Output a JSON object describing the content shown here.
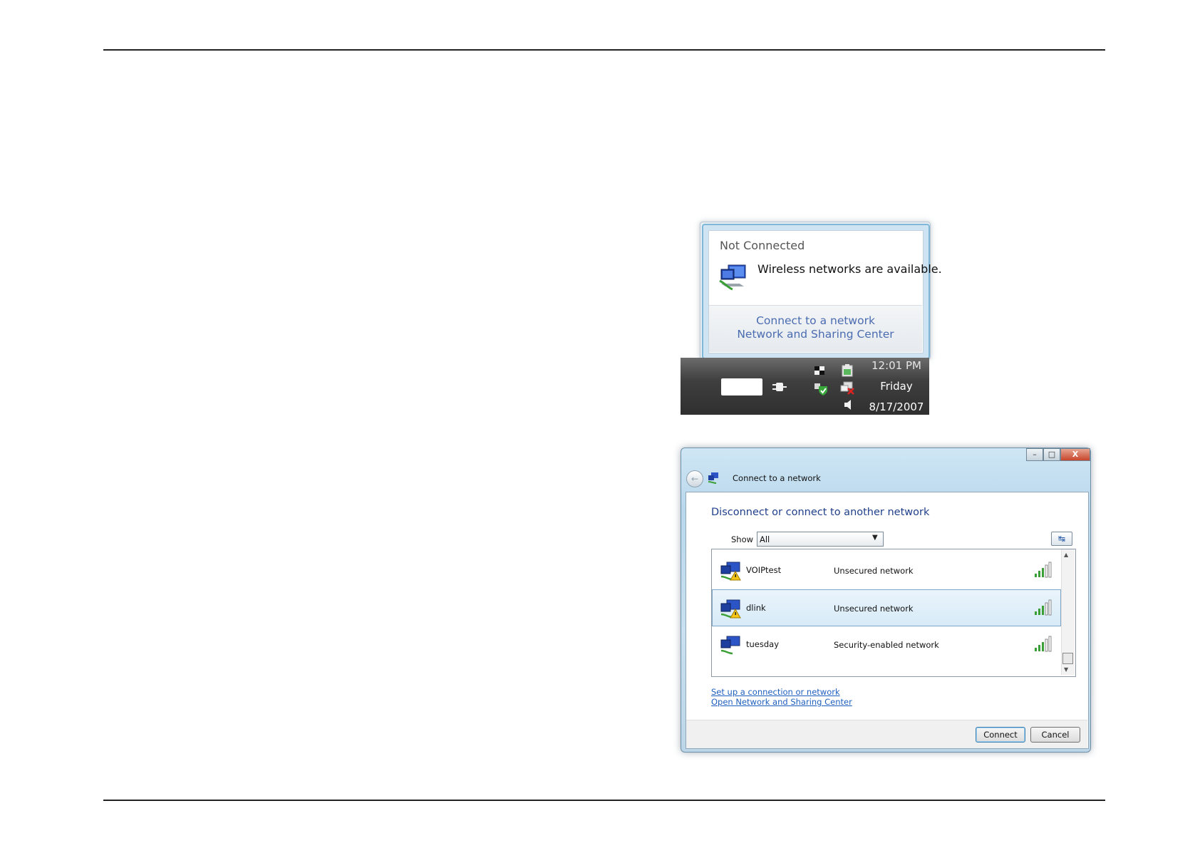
{
  "tray_popup": {
    "status": "Not Connected",
    "message": "Wireless networks are available.",
    "links": [
      "Connect to a network",
      "Network and Sharing Center"
    ]
  },
  "taskbar": {
    "time": "12:01 PM",
    "day": "Friday",
    "date": "8/17/2007"
  },
  "dialog": {
    "title": "Connect to a network",
    "heading": "Disconnect or connect to another network",
    "show_label": "Show",
    "show_value": "All",
    "networks": [
      {
        "name": "VOIPtest",
        "security": "Unsecured network",
        "selected": false
      },
      {
        "name": "dlink",
        "security": "Unsecured network",
        "selected": true
      },
      {
        "name": "tuesday",
        "security": "Security-enabled network",
        "selected": false
      }
    ],
    "links": [
      "Set up a connection or network",
      "Open Network and Sharing Center"
    ],
    "buttons": {
      "connect": "Connect",
      "cancel": "Cancel"
    },
    "window_controls": {
      "minimize": "–",
      "maximize": "□",
      "close": "X"
    }
  },
  "colors": {
    "link": "#4a6cb0",
    "heading": "#1f3f8a",
    "signal": "#3aa035"
  }
}
